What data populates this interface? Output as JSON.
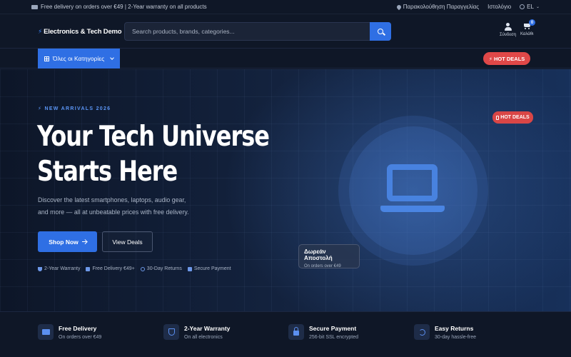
{
  "topbar": {
    "promo": "Free delivery on orders over €49 | 2-Year warranty on all products",
    "track_orders": "Παρακολούθηση Παραγγελίας",
    "blog": "Ιστολόγιο",
    "language": "EL"
  },
  "header": {
    "logo": "Electronics & Tech Demo",
    "search_placeholder": "Search products, brands, categories...",
    "login_label": "Σύνδεση",
    "cart_label": "Καλάθι",
    "cart_count": "0"
  },
  "nav": {
    "categories_label": "Όλες οι Κατηγορίες",
    "hot_deals": "HOT DEALS"
  },
  "hero": {
    "eyebrow": "NEW ARRIVALS 2026",
    "headline_line1": "Your Tech Universe",
    "headline_line2": "Starts Here",
    "subtitle_line1": "Discover the latest smartphones, laptops, audio gear,",
    "subtitle_line2": "and more — all at unbeatable prices with free delivery.",
    "primary_cta": "Shop Now",
    "secondary_cta": "View Deals",
    "trust": [
      "2-Year Warranty",
      "Free Delivery €49+",
      "30-Day Returns",
      "Secure Payment"
    ],
    "hot_badge": "HOT DEALS",
    "shipping_card_title": "Δωρεάν Αποστολή",
    "shipping_card_sub": "On orders over €49"
  },
  "features": [
    {
      "title": "Free Delivery",
      "sub": "On orders over €49",
      "icon": "truck-icon"
    },
    {
      "title": "2-Year Warranty",
      "sub": "On all electronics",
      "icon": "shield-icon"
    },
    {
      "title": "Secure Payment",
      "sub": "256-bit SSL encrypted",
      "icon": "lock-icon"
    },
    {
      "title": "Easy Returns",
      "sub": "30-day hassle-free",
      "icon": "return-icon"
    }
  ],
  "colors": {
    "accent": "#2f6fe4",
    "hot": "#e04848",
    "background": "#0c1322"
  }
}
